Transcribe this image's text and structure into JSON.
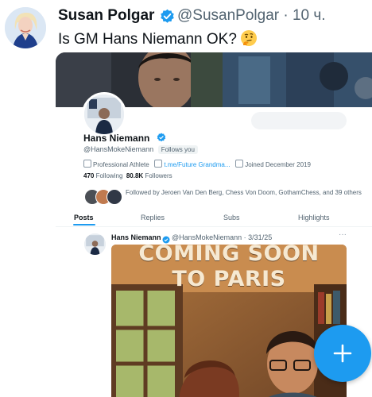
{
  "tweet": {
    "author_name": "Susan Polgar",
    "handle": "@SusanPolgar",
    "separator": "·",
    "time": "10 ч.",
    "text": "Is GM Hans Niemann OK?",
    "emoji": "thinking-face"
  },
  "embedded_profile": {
    "name": "Hans Niemann",
    "handle": "@HansMokeNiemann",
    "follows_you": "Follows you",
    "category": "Professional Athlete",
    "link": "t.me/Future Grandma...",
    "joined": "Joined December 2019",
    "following_count": "470",
    "following_label": "Following",
    "followers_count": "80.8K",
    "followers_label": "Followers",
    "followed_by": "Followed by Jeroen Van Den Berg, Chess Von Doom, GothamChess, and 39 others",
    "tabs": [
      "Posts",
      "Replies",
      "Subs",
      "Highlights"
    ],
    "active_tab": "Posts"
  },
  "pinned_post": {
    "name": "Hans Niemann",
    "handle": "@HansMokeNiemann",
    "date": "3/31/25",
    "more": "···",
    "poster_line1": "COMING SOON",
    "poster_line2": "TO PARIS"
  },
  "fab": {
    "icon": "plus-icon",
    "color": "#1d9bf0"
  },
  "colors": {
    "accent": "#1d9bf0",
    "text": "#0f1419",
    "secondary": "#536471"
  }
}
